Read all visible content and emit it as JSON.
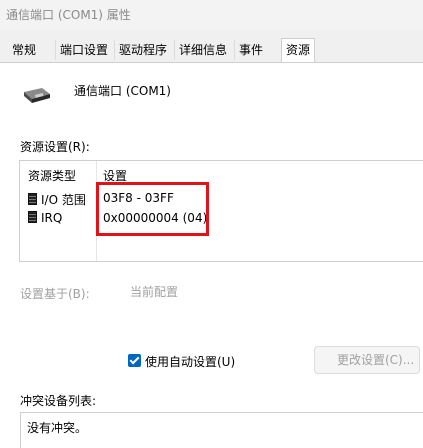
{
  "window": {
    "title": "通信端口 (COM1) 属性"
  },
  "tabs": [
    {
      "label": "常规"
    },
    {
      "label": "端口设置"
    },
    {
      "label": "驱动程序"
    },
    {
      "label": "详细信息"
    },
    {
      "label": "事件"
    },
    {
      "label": "资源"
    }
  ],
  "device": {
    "name": "通信端口 (COM1)",
    "icon": "serial-port-icon"
  },
  "resources": {
    "label": "资源设置(R):",
    "columns": {
      "type": "资源类型",
      "setting": "设置"
    },
    "rows": [
      {
        "type": "I/O 范围",
        "value": "03F8 - 03FF",
        "icon": "chip-icon"
      },
      {
        "type": "IRQ",
        "value": "0x00000004 (04)",
        "icon": "chip-icon"
      }
    ]
  },
  "based_on": {
    "label": "设置基于(B):",
    "value": "当前配置"
  },
  "auto_settings": {
    "label": "使用自动设置(U)",
    "checked": true
  },
  "change_button": {
    "label": "更改设置(C)..."
  },
  "conflicts": {
    "label": "冲突设备列表:",
    "text": "没有冲突。"
  },
  "colors": {
    "accent": "#0067c0",
    "highlight": "#e0131b"
  }
}
